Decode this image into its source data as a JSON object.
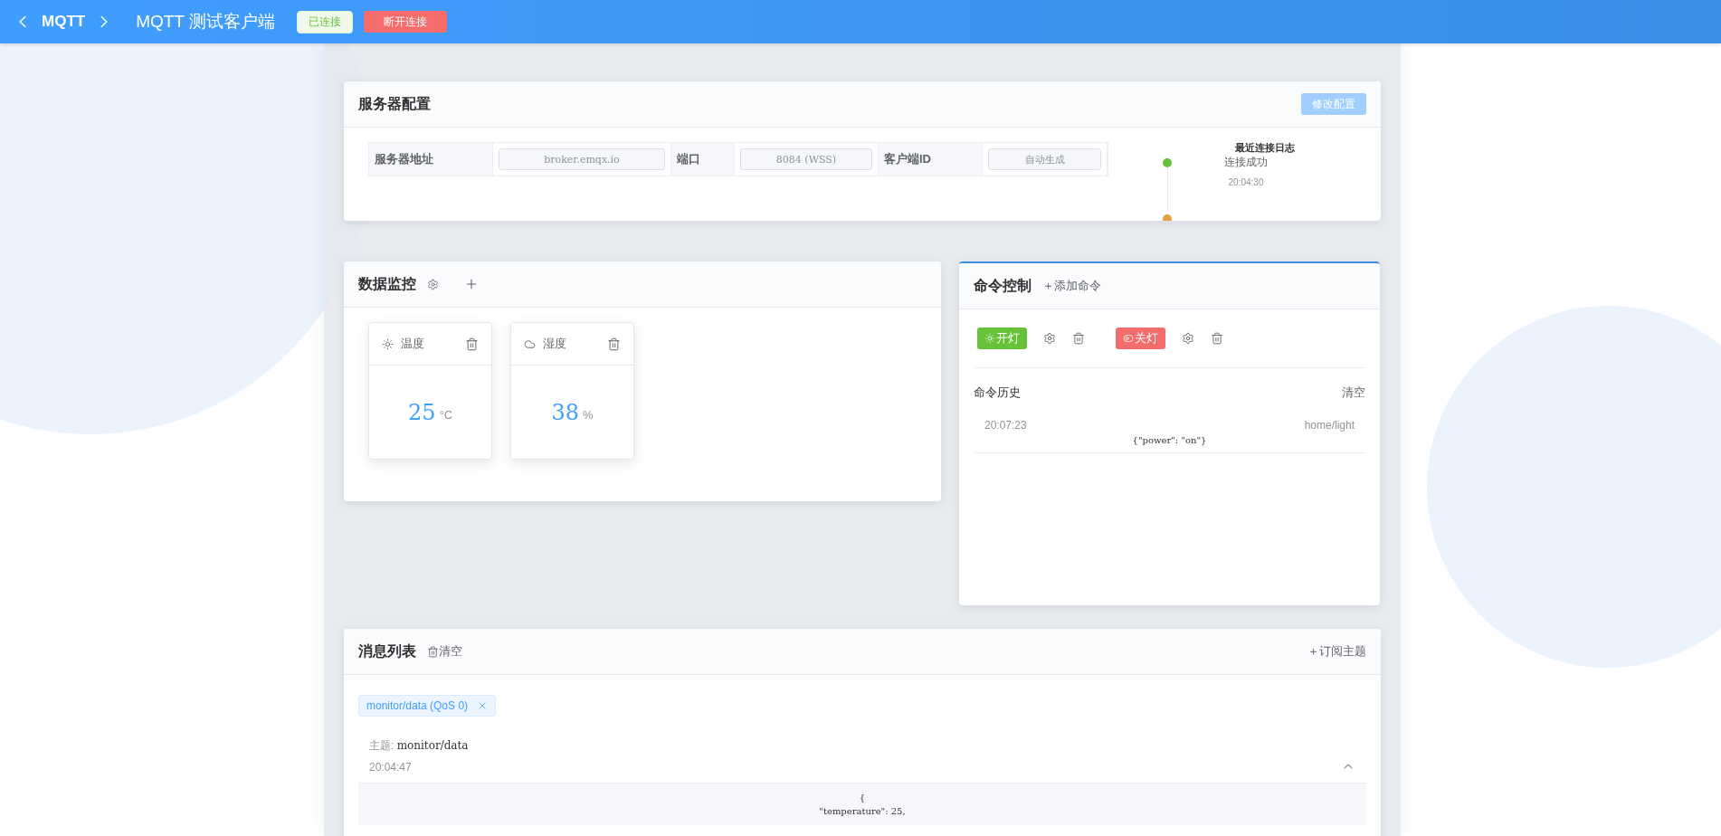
{
  "header": {
    "back_label": "MQTT",
    "title": "MQTT 测试客户端",
    "status_badge": {
      "text": "已连接",
      "connected": true
    },
    "disconnect_button": "断开连接"
  },
  "server_config": {
    "title": "服务器配置",
    "edit_button": {
      "label": "修改配置",
      "disabled": true
    },
    "fields": [
      {
        "label": "服务器地址",
        "value": "broker.emqx.io"
      },
      {
        "label": "端口",
        "value": "8084 (WSS)"
      },
      {
        "label": "客户端ID",
        "value": "自动生成"
      }
    ],
    "log": {
      "title": "最近连接日志",
      "entries": [
        {
          "text": "连接成功",
          "time": "20:04:30",
          "color": "#67c23a"
        },
        {
          "color": "#e6a23c"
        }
      ]
    }
  },
  "data_monitor": {
    "title": "数据监控",
    "sensors": [
      {
        "kind": "temperature",
        "name": "温度",
        "value": "25",
        "unit": "°C"
      },
      {
        "kind": "humidity",
        "name": "湿度",
        "value": "38",
        "unit": "%"
      }
    ]
  },
  "command_control": {
    "title": "命令控制",
    "add_link": "＋添加命令",
    "commands": [
      {
        "kind": "on",
        "label": "开灯"
      },
      {
        "kind": "off",
        "label": "关灯"
      }
    ],
    "history_title": "命令历史",
    "clear_link": "清空",
    "history": [
      {
        "time": "20:07:23",
        "topic": "home/light",
        "payload": "{\"power\": \"on\"}"
      }
    ]
  },
  "messages": {
    "title": "消息列表",
    "clear_link": "清空",
    "subscribe_link": "＋订阅主题",
    "subscriptions": [
      {
        "label": "monitor/data (QoS 0)"
      }
    ],
    "items": [
      {
        "topic_label": "主题:",
        "topic": "monitor/data",
        "time": "20:04:47",
        "expanded": true,
        "payload_lines": [
          "{",
          "\"temperature\": 25,"
        ]
      }
    ]
  }
}
